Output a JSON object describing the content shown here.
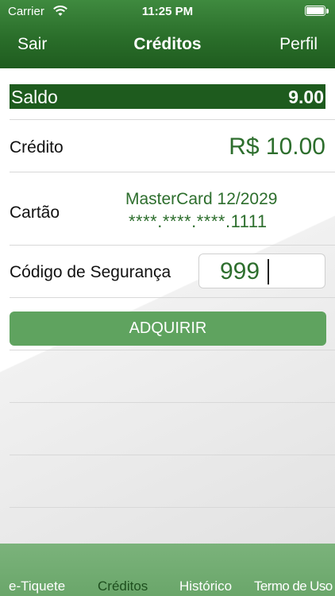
{
  "status_bar": {
    "carrier": "Carrier",
    "time": "11:25 PM"
  },
  "nav": {
    "left_label": "Sair",
    "title": "Créditos",
    "right_label": "Perfil"
  },
  "saldo": {
    "label": "Saldo",
    "value": "9.00"
  },
  "credito": {
    "label": "Crédito",
    "value": "R$ 10.00"
  },
  "cartao": {
    "label": "Cartão",
    "name": "MasterCard 12/2029",
    "number": "****.****.****.1111"
  },
  "codigo": {
    "label": "Código de Segurança",
    "value": "999"
  },
  "buy_button": {
    "label": "ADQUIRIR"
  },
  "tabs": [
    {
      "label": "e-Tiquete"
    },
    {
      "label": "Créditos"
    },
    {
      "label": "Histórico"
    },
    {
      "label": "Termo de Uso"
    }
  ],
  "colors": {
    "primary": "#2a6e2a",
    "button": "#5fa35f",
    "tab_bar": "#6aa66a",
    "value_text": "#2d6e2d"
  },
  "icons": {
    "wifi": "wifi-icon",
    "battery": "battery-icon"
  }
}
